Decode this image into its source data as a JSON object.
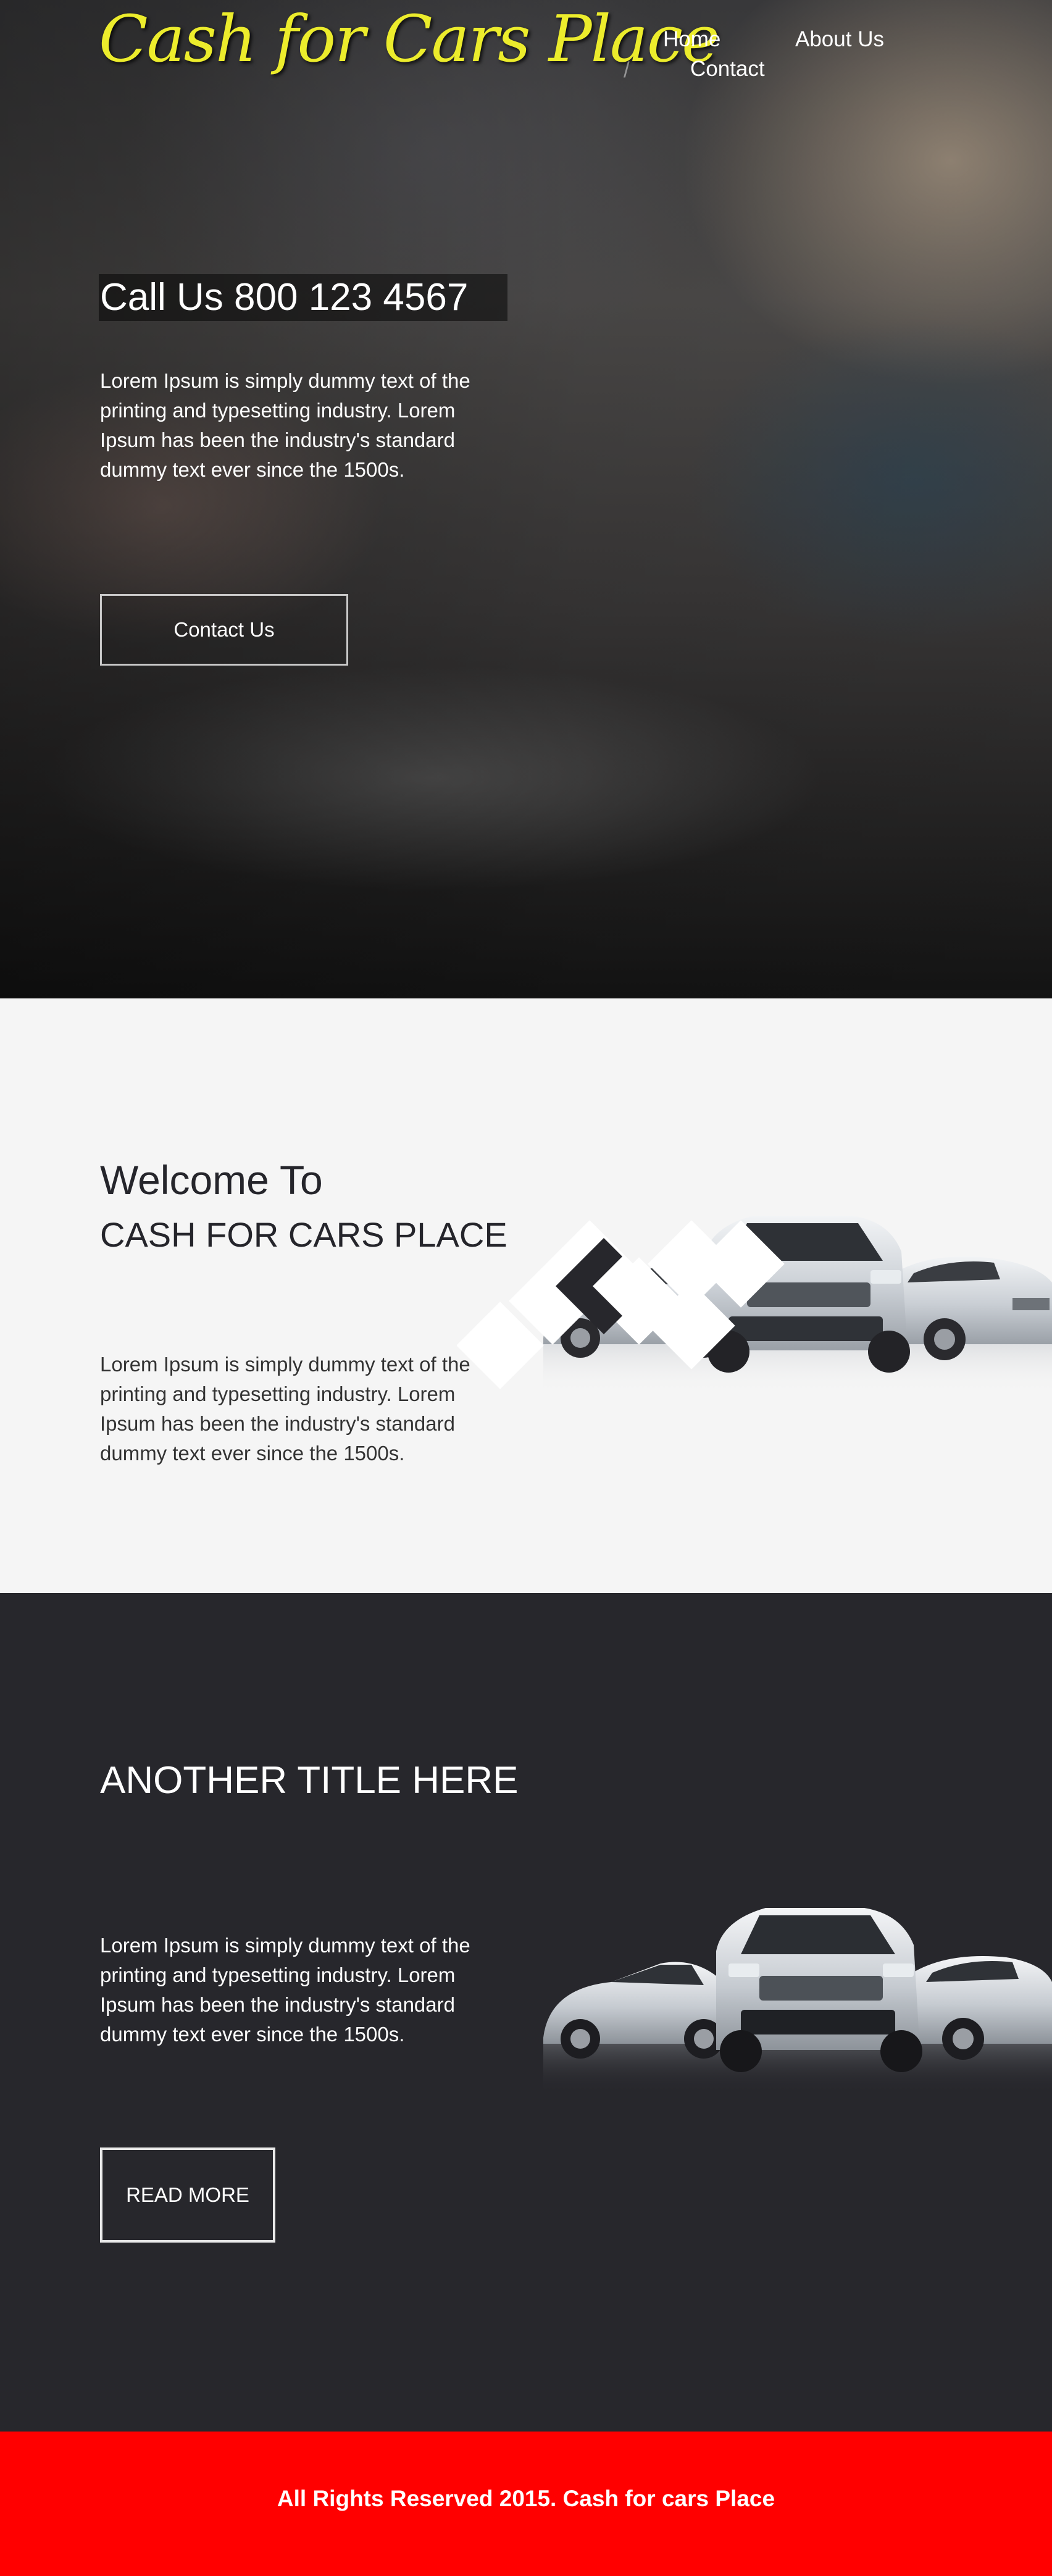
{
  "header": {
    "logo": "Cash for Cars Place",
    "nav": {
      "home": "Home",
      "about": "About Us",
      "separator": "/",
      "contact": "Contact"
    }
  },
  "hero": {
    "title": "Call Us 800 123 4567",
    "text": "Lorem Ipsum is simply dummy text of the printing and typesetting industry. Lorem Ipsum has been the industry's standard dummy text ever since the 1500s.",
    "button": "Contact Us"
  },
  "welcome": {
    "heading": "Welcome To",
    "subheading": "CASH FOR CARS PLACE",
    "text": "Lorem Ipsum is simply dummy text of the printing and typesetting industry. Lorem Ipsum has been the industry's standard dummy text ever since the 1500s."
  },
  "another": {
    "title": "ANOTHER TITLE HERE",
    "text": "Lorem Ipsum is simply dummy text of the printing and typesetting industry. Lorem Ipsum has been the industry's standard dummy text ever since the 1500s.",
    "button": "READ MORE"
  },
  "footer": {
    "text": "All Rights Reserved 2015. Cash for cars Place"
  },
  "colors": {
    "logo": "#ecec2c",
    "dark_section": "#27272c",
    "footer": "#ff0000",
    "light_section": "#f5f5f5"
  }
}
